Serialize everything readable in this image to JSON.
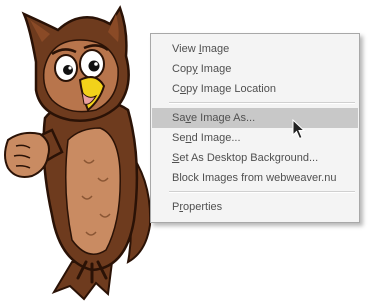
{
  "context_menu": {
    "items": [
      {
        "pre": "View ",
        "key": "I",
        "post": "mage"
      },
      {
        "pre": "Cop",
        "key": "y",
        "post": " Image"
      },
      {
        "pre": "C",
        "key": "o",
        "post": "py Image Location"
      },
      {
        "pre": "Sa",
        "key": "v",
        "post": "e Image As..."
      },
      {
        "pre": "Se",
        "key": "n",
        "post": "d Image..."
      },
      {
        "pre": "",
        "key": "S",
        "post": "et As Desktop Background..."
      },
      {
        "pre": "Block Ima",
        "key": "g",
        "post": "es from webweaver.nu"
      },
      {
        "pre": "P",
        "key": "r",
        "post": "operties"
      }
    ],
    "highlighted_index": 3
  },
  "colors": {
    "menu_background": "#f4f4f4",
    "menu_highlight": "#c8c8c8",
    "menu_text": "#505050",
    "owl_body": "#6e3b1e",
    "owl_belly": "#c98b62",
    "owl_beak": "#f2d21a"
  },
  "icons": {
    "cursor": "arrow-cursor-icon",
    "illustration": "cartoon-owl-pointing"
  }
}
